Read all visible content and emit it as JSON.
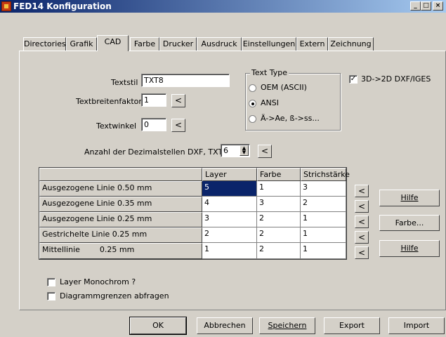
{
  "window": {
    "title": "FED14 Konfiguration",
    "controls": {
      "minimize": "_",
      "maximize": "□",
      "close": "×"
    }
  },
  "tabs": [
    "Directories",
    "Grafik",
    "CAD",
    "Farbe",
    "Drucker",
    "Ausdruck",
    "Einstellungen",
    "Extern",
    "Zeichnung"
  ],
  "active_tab": "CAD",
  "fields": {
    "textstil": {
      "label": "Textstil",
      "value": "TXT8"
    },
    "textbreitenfaktor": {
      "label": "Textbreitenfaktor",
      "value": "1"
    },
    "textwinkel": {
      "label": "Textwinkel",
      "value": "0"
    },
    "dezimalstellen": {
      "label": "Anzahl der Dezimalstellen DXF, TXT",
      "value": "6"
    },
    "small_button": "<"
  },
  "text_type": {
    "title": "Text Type",
    "options": [
      "OEM (ASCII)",
      "ANSI",
      "Ä->Ae, ß->ss..."
    ],
    "selected": "ANSI"
  },
  "checkbox_3d": {
    "label": "3D->2D DXF/IGES",
    "checked": true
  },
  "table": {
    "columns": [
      "Layer",
      "Farbe",
      "Strichstärke"
    ],
    "rows": [
      {
        "name": "Ausgezogene  Linie  0.50 mm",
        "layer": "5",
        "farbe": "1",
        "strich": "3"
      },
      {
        "name": "Ausgezogene  Linie  0.35 mm",
        "layer": "4",
        "farbe": "3",
        "strich": "2"
      },
      {
        "name": "Ausgezogene  Linie  0.25 mm",
        "layer": "3",
        "farbe": "2",
        "strich": "1"
      },
      {
        "name": "Gestrichelte Linie  0.25 mm",
        "layer": "2",
        "farbe": "2",
        "strich": "1"
      },
      {
        "name": "Mittellinie        0.25 mm",
        "layer": "1",
        "farbe": "2",
        "strich": "1"
      }
    ]
  },
  "side_buttons": {
    "hilfe1": "Hilfe",
    "farbe": "Farbe...",
    "hilfe2": "Hilfe"
  },
  "options": {
    "layer_monochrom": {
      "label": "Layer Monochrom ?",
      "checked": false
    },
    "diagrammgrenzen": {
      "label": "Diagrammgrenzen abfragen",
      "checked": false
    }
  },
  "bottom_buttons": {
    "ok": "OK",
    "abbrechen": "Abbrechen",
    "speichern": "Speichern",
    "export": "Export",
    "import": "Import"
  }
}
